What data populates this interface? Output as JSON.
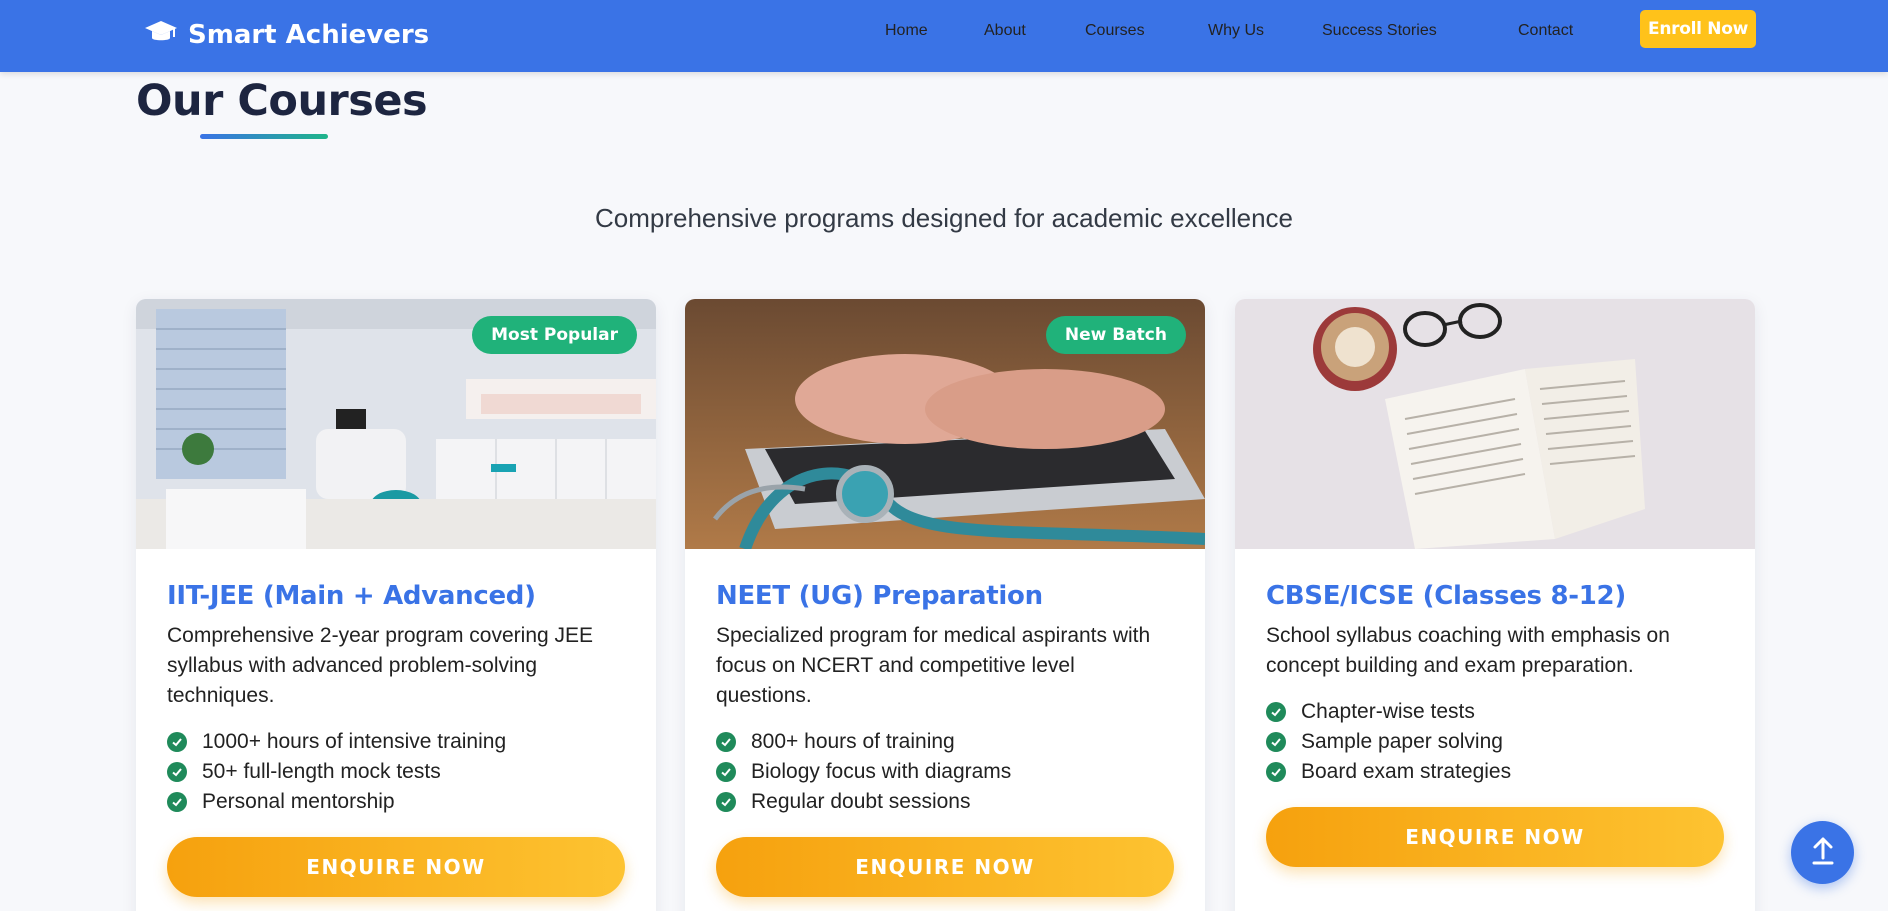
{
  "brand": {
    "name": "Smart Achievers",
    "icon": "graduation-cap-icon"
  },
  "nav": {
    "items": [
      "Home",
      "About",
      "Courses",
      "Why Us",
      "Success Stories",
      "Contact"
    ],
    "enroll_label": "Enroll Now"
  },
  "section": {
    "title": "Our Courses",
    "subtitle": "Comprehensive programs designed for academic excellence"
  },
  "courses": [
    {
      "badge": "Most Popular",
      "title": "IIT-JEE (Main + Advanced)",
      "description": "Comprehensive 2-year program covering JEE syllabus with advanced problem-solving techniques.",
      "features": [
        "1000+ hours of intensive training",
        "50+ full-length mock tests",
        "Personal mentorship"
      ],
      "button": "ENQUIRE NOW",
      "image": "clinic-room-photo"
    },
    {
      "badge": "New Batch",
      "title": "NEET (UG) Preparation",
      "description": "Specialized program for medical aspirants with focus on NCERT and competitive level questions.",
      "features": [
        "800+ hours of training",
        "Biology focus with diagrams",
        "Regular doubt sessions"
      ],
      "button": "ENQUIRE NOW",
      "image": "laptop-stethoscope-photo"
    },
    {
      "badge": "",
      "title": "CBSE/ICSE (Classes 8-12)",
      "description": "School syllabus coaching with emphasis on concept building and exam preparation.",
      "features": [
        "Chapter-wise tests",
        "Sample paper solving",
        "Board exam strategies"
      ],
      "button": "ENQUIRE NOW",
      "image": "book-coffee-glasses-photo"
    }
  ],
  "colors": {
    "primary": "#3a73e6",
    "accent": "#ffc21a",
    "badge": "#20b27a",
    "check": "#1f8a5a"
  },
  "back_to_top_icon": "arrow-up-icon"
}
